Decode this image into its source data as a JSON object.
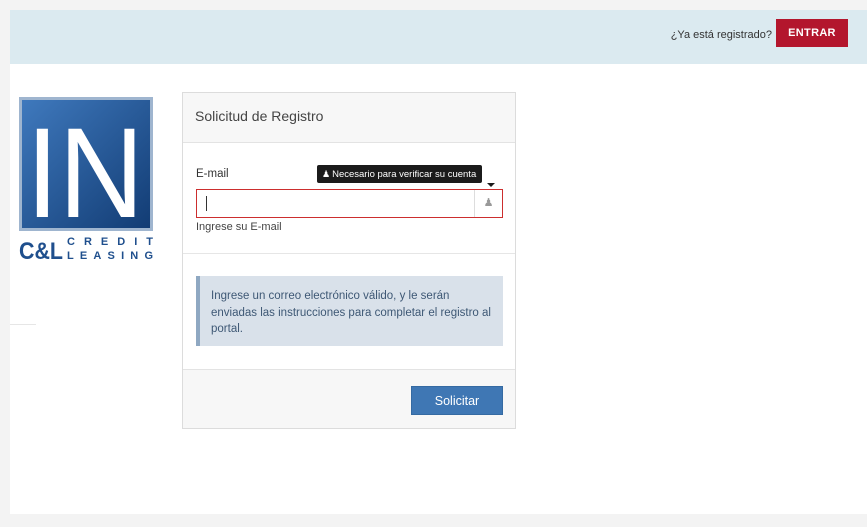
{
  "header": {
    "already_registered": "¿Ya está registrado?",
    "login_label": "ENTRAR"
  },
  "logo": {
    "big_letters": "IN",
    "mark": "C&L",
    "word1": "CREDIT",
    "word2": "LEASING"
  },
  "form": {
    "title": "Solicitud de Registro",
    "email_label": "E-mail",
    "email_value": "",
    "tooltip": "Necesario para verificar su cuenta",
    "help_text": "Ingrese su E-mail",
    "info_text": "Ingrese un correo electrónico válido, y le serán enviadas las instrucciones para completar el registro al portal.",
    "submit_label": "Solicitar"
  },
  "icons": {
    "user": "user-icon"
  },
  "colors": {
    "header_bg": "#dbeaf0",
    "login_button": "#b3162d",
    "submit_button": "#3f77b4",
    "error_border": "#cc2e2e",
    "info_bg": "#d9e1ea",
    "logo_blue": "#1f4f8d"
  }
}
